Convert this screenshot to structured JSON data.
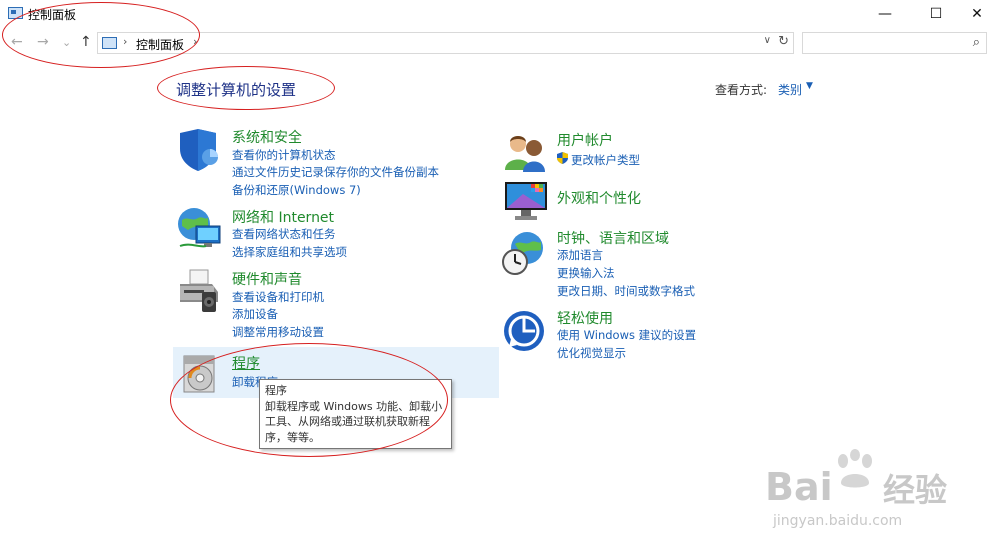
{
  "window": {
    "title": "控制面板",
    "minimize": "—",
    "maximize": "☐",
    "close": "✕"
  },
  "nav": {
    "back": "←",
    "forward": "→",
    "recent": "⌄",
    "up": "↑"
  },
  "address": {
    "separator": "›",
    "path": "控制面板",
    "dropdown": "∨",
    "refresh": "↻"
  },
  "search": {
    "placeholder": "",
    "icon": "⌕"
  },
  "page": {
    "title": "调整计算机的设置",
    "view_by_label": "查看方式:",
    "view_by_value": "类别",
    "view_by_caret": "▼"
  },
  "categories": [
    {
      "title": "系统和安全",
      "icon": "shield-icon",
      "links": [
        "查看你的计算机状态",
        "通过文件历史记录保存你的文件备份副本",
        "备份和还原(Windows 7)"
      ]
    },
    {
      "title": "网络和 Internet",
      "icon": "network-globe-icon",
      "links": [
        "查看网络状态和任务",
        "选择家庭组和共享选项"
      ]
    },
    {
      "title": "硬件和声音",
      "icon": "printer-icon",
      "links": [
        "查看设备和打印机",
        "添加设备",
        "调整常用移动设置"
      ]
    },
    {
      "title": "程序",
      "icon": "programs-disc-icon",
      "links": [
        "卸载程序"
      ]
    },
    {
      "title": "用户帐户",
      "icon": "users-icon",
      "links": [
        "更改帐户类型"
      ]
    },
    {
      "title": "外观和个性化",
      "icon": "monitor-icon",
      "links": []
    },
    {
      "title": "时钟、语言和区域",
      "icon": "clock-globe-icon",
      "links": [
        "添加语言",
        "更换输入法",
        "更改日期、时间或数字格式"
      ]
    },
    {
      "title": "轻松使用",
      "icon": "accessibility-icon",
      "links": [
        "使用 Windows 建议的设置",
        "优化视觉显示"
      ]
    }
  ],
  "tooltip": {
    "title": "程序",
    "body": [
      "卸载程序或 Windows 功能、卸载小",
      "工具、从网络或通过联机获取新程",
      "序，等等。"
    ]
  },
  "watermark": {
    "brand": "Bai",
    "brand2": "经验",
    "url": "jingyan.baidu.com"
  },
  "colors": {
    "category_title": "#208a2d",
    "link": "#1a5fb4",
    "heading": "#1e3287",
    "annotation": "#d62020",
    "hover": "#e5f1fb"
  }
}
